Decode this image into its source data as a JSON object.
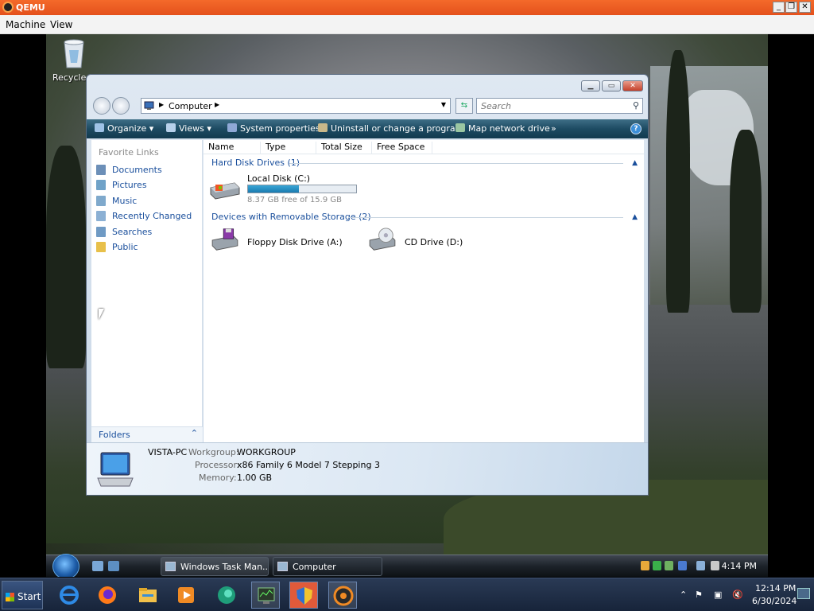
{
  "host": {
    "window_title": "QEMU",
    "menu": [
      "Machine",
      "View"
    ],
    "start_label": "Start",
    "clock_time": "12:14 PM",
    "clock_date": "6/30/2024"
  },
  "desktop": {
    "recycle_bin_label": "Recycle E"
  },
  "explorer": {
    "address": "Computer",
    "search_placeholder": "Search",
    "toolbar": {
      "organize": "Organize",
      "views": "Views",
      "system_properties": "System properties",
      "uninstall": "Uninstall or change a program",
      "map_network": "Map network drive",
      "more": "»"
    },
    "favorite_links_title": "Favorite Links",
    "favorites": [
      "Documents",
      "Pictures",
      "Music",
      "Recently Changed",
      "Searches",
      "Public"
    ],
    "folders_label": "Folders",
    "columns": [
      "Name",
      "Type",
      "Total Size",
      "Free Space"
    ],
    "groups": {
      "hdd": "Hard Disk Drives (1)",
      "removable": "Devices with Removable Storage (2)"
    },
    "drives": {
      "local": {
        "name": "Local Disk (C:)",
        "free_text": "8.37 GB free of 15.9 GB",
        "used_fraction": 0.47
      },
      "floppy": {
        "name": "Floppy Disk Drive (A:)"
      },
      "cd": {
        "name": "CD Drive (D:)"
      }
    },
    "details": {
      "computer_name": "VISTA-PC",
      "workgroup_label": "Workgroup:",
      "workgroup_value": "WORKGROUP",
      "processor_label": "Processor:",
      "processor_value": "x86 Family 6 Model 7 Stepping 3",
      "memory_label": "Memory:",
      "memory_value": "1.00 GB"
    }
  },
  "guest_taskbar": {
    "tasks": [
      "Windows Task Man...",
      "Computer"
    ],
    "clock": "4:14 PM"
  }
}
